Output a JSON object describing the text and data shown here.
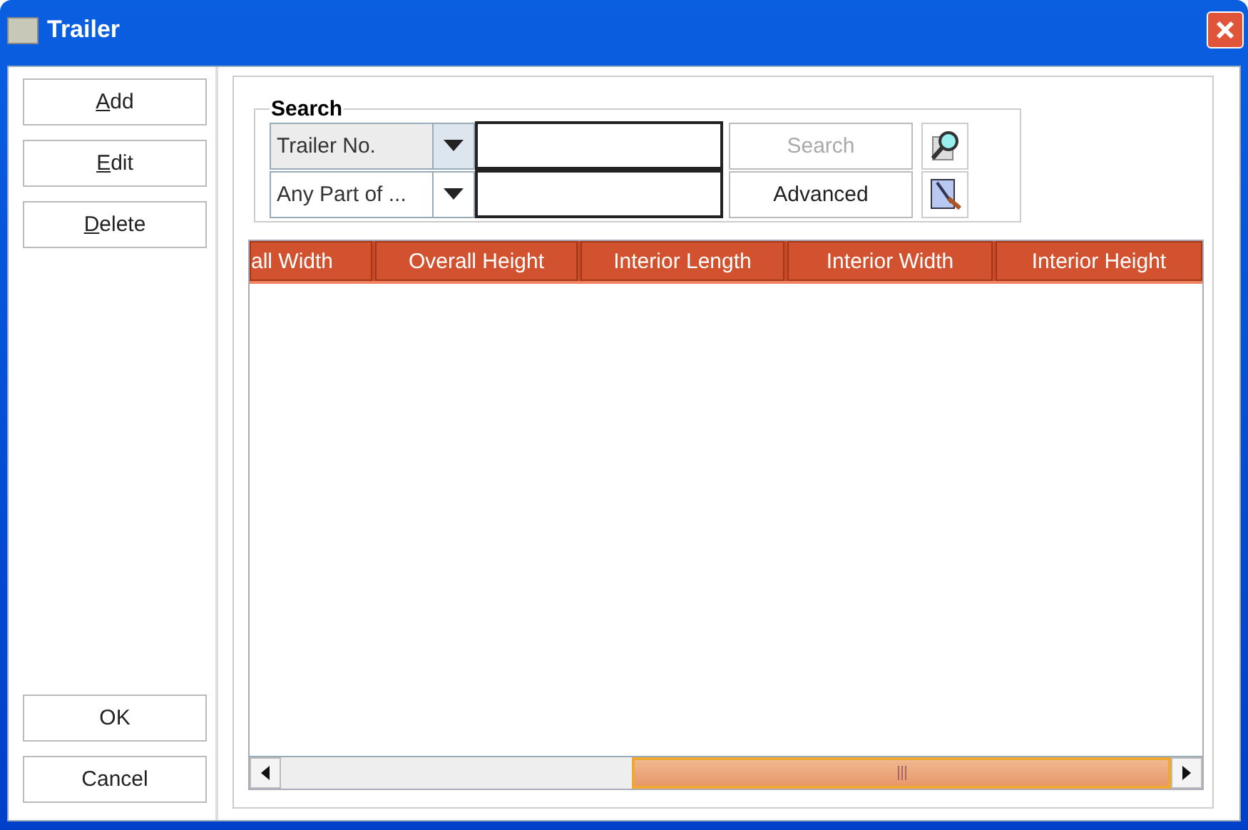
{
  "window": {
    "title": "Trailer"
  },
  "actions": [
    {
      "label": "Add",
      "mnemonic": true
    },
    {
      "label": "Edit",
      "mnemonic": true
    },
    {
      "label": "Delete",
      "mnemonic": true
    }
  ],
  "dialog_buttons": [
    {
      "label": "OK",
      "mnemonic": false
    },
    {
      "label": "Cancel",
      "mnemonic": false
    }
  ],
  "search": {
    "title": "Search",
    "rows": [
      {
        "field": "Trailer No.",
        "field_selected": true,
        "button": "Search",
        "disabled": true,
        "kind": "search"
      },
      {
        "field": "Any Part of ...",
        "field_selected": false,
        "button": "Advanced",
        "disabled": false,
        "kind": "advanced"
      }
    ]
  },
  "table": {
    "columns": [
      "all Width",
      "Overall Height",
      "Interior Length",
      "Interior Width",
      "Interior Height"
    ]
  }
}
